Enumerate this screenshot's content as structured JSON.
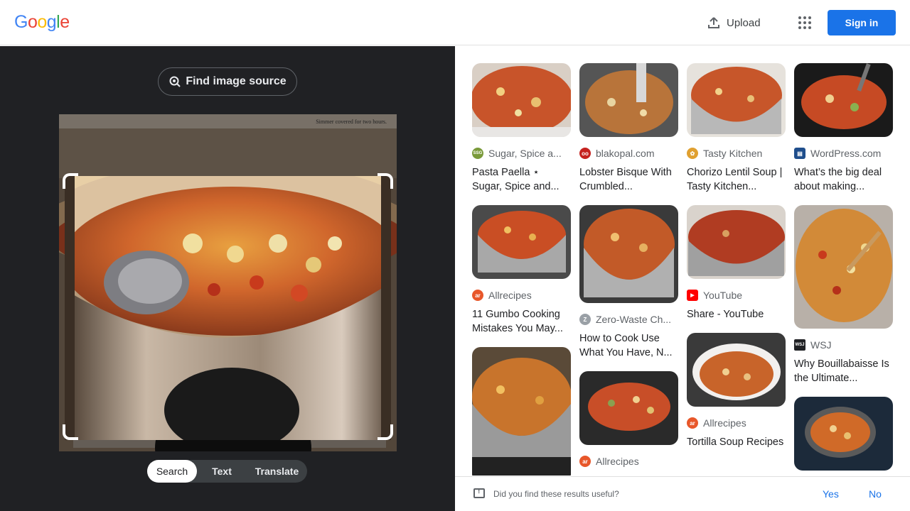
{
  "header": {
    "logo": "Google",
    "upload_label": "Upload",
    "signin_label": "Sign in"
  },
  "left": {
    "find_source_label": "Find image source",
    "image_caption": "Simmer covered for two hours.",
    "modes": [
      "Search",
      "Text",
      "Translate"
    ],
    "active_mode": "Search"
  },
  "results": [
    {
      "source": "Sugar, Spice a...",
      "title": "Pasta Paella ⋆ Sugar, Spice and...",
      "fav_text": "SSG",
      "fav_color": "#7a9a3a"
    },
    {
      "source": "blakopal.com",
      "title": "Lobster Bisque With Crumbled...",
      "fav_text": "oo",
      "fav_color": "#c5221f"
    },
    {
      "source": "Tasty Kitchen",
      "title": "Chorizo Lentil Soup | Tasty Kitchen...",
      "fav_text": "✿",
      "fav_color": "#e0a030"
    },
    {
      "source": "WordPress.com",
      "title": "What’s the big deal about making...",
      "fav_text": "▤",
      "fav_color": "#1f4e8c"
    },
    {
      "source": "Allrecipes",
      "title": "11 Gumbo Cooking Mistakes You May...",
      "fav_text": "ar",
      "fav_color": "#e8572a"
    },
    {
      "source": "Zero-Waste Ch...",
      "title": "How to Cook Use What You Have, N...",
      "fav_text": "Z",
      "fav_color": "#9aa0a6"
    },
    {
      "source": "YouTube",
      "title": "Share - YouTube",
      "fav_text": "▶",
      "fav_color": "#ff0000"
    },
    {
      "source": "WSJ",
      "title": "Why Bouillabaisse Is the Ultimate...",
      "fav_text": "WSJ",
      "fav_color": "#202124"
    },
    {
      "source": "",
      "title": "",
      "fav_text": "",
      "fav_color": ""
    },
    {
      "source": "Allrecipes",
      "title": "",
      "fav_text": "ar",
      "fav_color": "#e8572a"
    },
    {
      "source": "Allrecipes",
      "title": "Tortilla Soup Recipes",
      "fav_text": "ar",
      "fav_color": "#e8572a"
    },
    {
      "source": "",
      "title": "",
      "fav_text": "",
      "fav_color": ""
    }
  ],
  "feedback": {
    "question": "Did you find these results useful?",
    "yes": "Yes",
    "no": "No"
  }
}
